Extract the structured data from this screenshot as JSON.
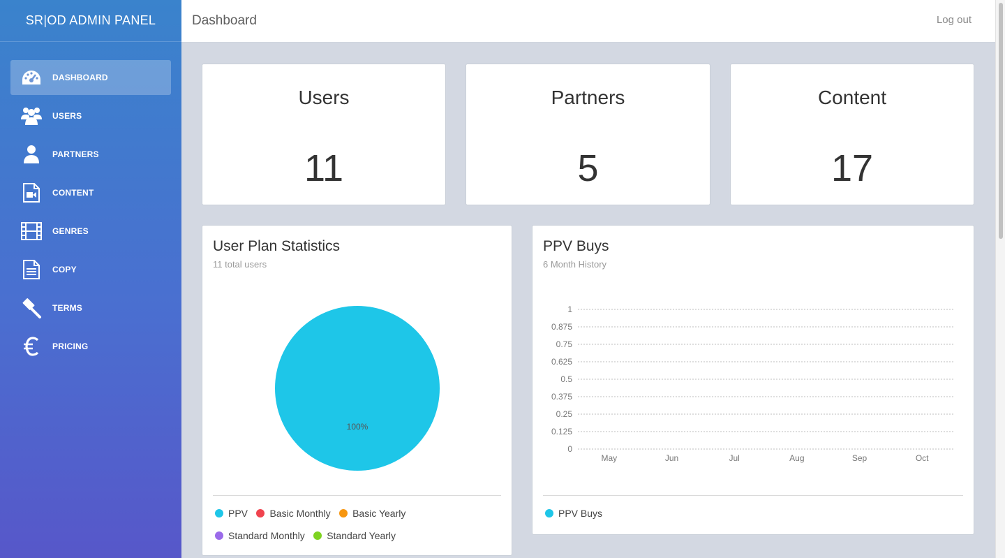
{
  "app": {
    "brand": "SR|OD ADMIN PANEL"
  },
  "header": {
    "title": "Dashboard",
    "logout_label": "Log out"
  },
  "sidebar": {
    "items": [
      {
        "label": "DASHBOARD",
        "icon": "dashboard-icon",
        "active": true
      },
      {
        "label": "USERS",
        "icon": "users-icon"
      },
      {
        "label": "PARTNERS",
        "icon": "user-icon"
      },
      {
        "label": "CONTENT",
        "icon": "video-file-icon"
      },
      {
        "label": "GENRES",
        "icon": "film-icon"
      },
      {
        "label": "COPY",
        "icon": "document-icon"
      },
      {
        "label": "TERMS",
        "icon": "gavel-icon"
      },
      {
        "label": "PRICING",
        "icon": "euro-icon"
      }
    ]
  },
  "stats": [
    {
      "title": "Users",
      "value": "11"
    },
    {
      "title": "Partners",
      "value": "5"
    },
    {
      "title": "Content",
      "value": "17"
    }
  ],
  "user_plan": {
    "title": "User Plan Statistics",
    "subtitle": "11 total users",
    "slice_label": "100%",
    "legend": [
      {
        "label": "PPV",
        "color": "#1ec6e8"
      },
      {
        "label": "Basic Monthly",
        "color": "#f0434e"
      },
      {
        "label": "Basic Yearly",
        "color": "#f7960f"
      },
      {
        "label": "Standard Monthly",
        "color": "#9b6bea"
      },
      {
        "label": "Standard Yearly",
        "color": "#7ed321"
      }
    ]
  },
  "ppv": {
    "title": "PPV Buys",
    "subtitle": "6 Month History",
    "legend": [
      {
        "label": "PPV Buys",
        "color": "#1ec6e8"
      }
    ]
  },
  "chart_data": [
    {
      "type": "pie",
      "title": "User Plan Statistics",
      "subtitle": "11 total users",
      "categories": [
        "PPV",
        "Basic Monthly",
        "Basic Yearly",
        "Standard Monthly",
        "Standard Yearly"
      ],
      "values": [
        100,
        0,
        0,
        0,
        0
      ],
      "colors": [
        "#1ec6e8",
        "#f0434e",
        "#f7960f",
        "#9b6bea",
        "#7ed321"
      ],
      "data_labels": [
        "100%"
      ],
      "legend_position": "bottom"
    },
    {
      "type": "line",
      "title": "PPV Buys",
      "subtitle": "6 Month History",
      "categories": [
        "May",
        "Jun",
        "Jul",
        "Aug",
        "Sep",
        "Oct"
      ],
      "series": [
        {
          "name": "PPV Buys",
          "values": [
            0,
            0,
            0,
            0,
            0,
            0
          ],
          "color": "#1ec6e8"
        }
      ],
      "ylim": [
        0,
        1
      ],
      "yticks": [
        "0",
        "0.125",
        "0.25",
        "0.375",
        "0.5",
        "0.625",
        "0.75",
        "0.875",
        "1"
      ],
      "grid": true,
      "legend_position": "bottom"
    }
  ]
}
